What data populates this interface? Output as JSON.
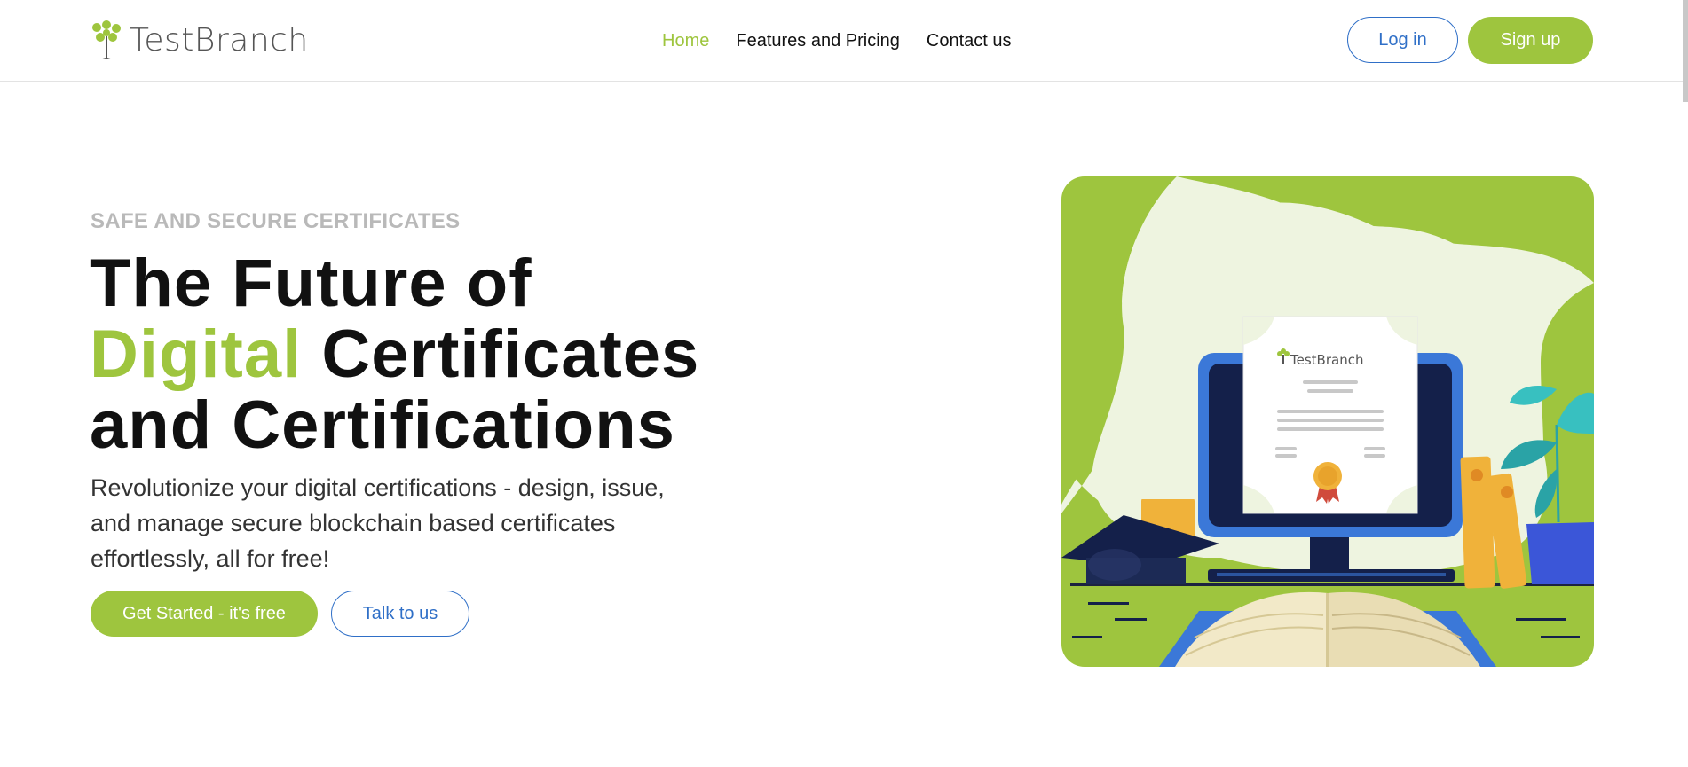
{
  "header": {
    "logo_text": "TestBranch",
    "nav": [
      {
        "label": "Home",
        "active": true
      },
      {
        "label": "Features and Pricing",
        "active": false
      },
      {
        "label": "Contact us",
        "active": false
      }
    ],
    "login_label": "Log in",
    "signup_label": "Sign up"
  },
  "hero": {
    "eyebrow": "SAFE AND SECURE CERTIFICATES",
    "title_line1": "The Future of",
    "title_accent": "Digital",
    "title_line2_rest": " Certificates",
    "title_line3": "and Certifications",
    "subtitle": "Revolutionize your digital certifications - design, issue, and manage secure blockchain based certificates effortlessly, all for free!",
    "cta_primary": "Get Started - it's free",
    "cta_secondary": "Talk to us"
  },
  "illustration": {
    "certificate_logo_text": "TestBranch"
  },
  "colors": {
    "brand_green": "#9ec53e",
    "brand_blue": "#2f6fc7"
  }
}
